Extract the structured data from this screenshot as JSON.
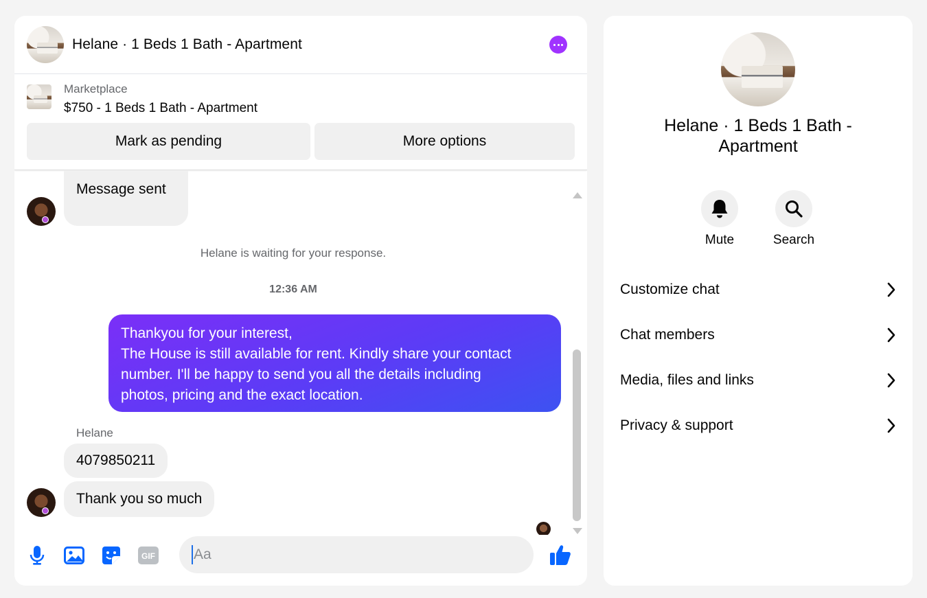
{
  "header": {
    "title": "Helane · 1 Beds 1 Bath - Apartment"
  },
  "listing": {
    "source": "Marketplace",
    "title": "$750 - 1 Beds 1 Bath - Apartment",
    "mark_pending_label": "Mark as pending",
    "more_options_label": "More options"
  },
  "messages": {
    "first_incoming": "Message sent",
    "status": "Helane is waiting for your response.",
    "timestamp": "12:36 AM",
    "outgoing_lines": [
      "Thankyou for your interest,",
      "The House is still available for rent. Kindly share your contact",
      "number. I'll be happy to send you all the details including",
      "photos, pricing and the exact location."
    ],
    "sender_name": "Helane",
    "reply_1": "4079850211",
    "reply_2": "Thank you so much"
  },
  "composer": {
    "placeholder": "Aa",
    "gif_label": "GIF"
  },
  "info": {
    "name_line_1": "Helane · 1 Beds 1 Bath -",
    "name_line_2": "Apartment",
    "mute_label": "Mute",
    "search_label": "Search",
    "menu": [
      {
        "label": "Customize chat"
      },
      {
        "label": "Chat members"
      },
      {
        "label": "Media, files and links"
      },
      {
        "label": "Privacy & support"
      }
    ]
  },
  "colors": {
    "accent": "#0866ff",
    "more_button": "#a033ff",
    "bubble_out_start": "#7b2ff7",
    "bubble_out_end": "#3d52f2",
    "bubble_in": "#f0f0f0"
  }
}
